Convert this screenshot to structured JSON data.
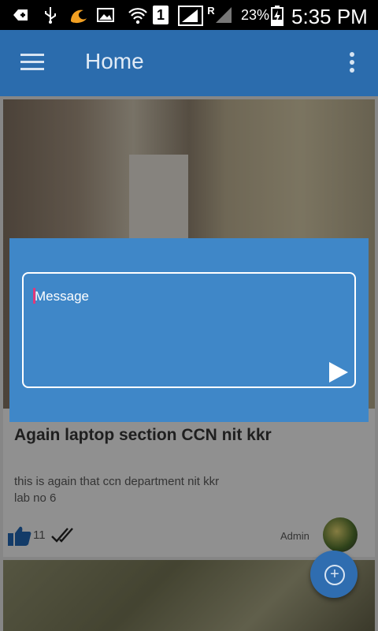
{
  "status_bar": {
    "battery_percent": "23%",
    "time": "5:35 PM",
    "sim_slot": "1",
    "roaming": "R",
    "icons": [
      "add-icon",
      "usb-icon",
      "uc-browser-icon",
      "image-icon",
      "wifi-icon",
      "sim-icon",
      "signal-icon",
      "signal-icon-2",
      "battery-charging-icon"
    ]
  },
  "app_bar": {
    "title": "Home",
    "menu_icon": "hamburger-menu-icon",
    "overflow_icon": "more-vert-icon"
  },
  "post": {
    "title": "Again laptop section CCN nit kkr",
    "body_line1": "this is again that ccn department nit kkr",
    "body_line2": "lab no 6",
    "likes": "11",
    "author": "Admin"
  },
  "dialog": {
    "placeholder": "Message",
    "send_icon": "send-icon"
  },
  "fab": {
    "icon": "add-circle-icon"
  },
  "colors": {
    "app_bar": "#2b6cad",
    "dialog": "#3f87c8",
    "fab": "#2f6db0",
    "cursor": "#e0397a"
  }
}
